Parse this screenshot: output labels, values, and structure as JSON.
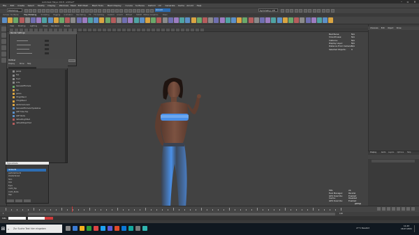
{
  "window": {
    "title": "Autodesk Maya 2018: untitled*",
    "minimize_icon": "minimize-icon",
    "maximize_icon": "maximize-icon",
    "close_icon": "close-icon"
  },
  "menubar": {
    "items": [
      "File",
      "Edit",
      "Create",
      "Select",
      "Modify",
      "Display",
      "Windows",
      "Mesh",
      "Edit Mesh",
      "Mesh Tools",
      "Mesh Display",
      "Curves",
      "Surfaces",
      "Deform",
      "UV",
      "Generate",
      "Cache",
      "Arnold",
      "Help"
    ]
  },
  "statusline": {
    "mode": "Modeling",
    "renderer": "Arnold",
    "panel": "Symmetry: Off"
  },
  "shelf": {
    "tabs": [
      "Curves / Surfaces",
      "Poly Modeling",
      "Sculpting",
      "Rigging",
      "Animation",
      "Rendering",
      "FX",
      "FX Caching",
      "Custom",
      "Arnold",
      "Bifrost",
      "MASH",
      "Motion Graphics",
      "XGen"
    ],
    "active_tab": "Poly Modeling"
  },
  "viewport": {
    "menu": [
      "View",
      "Shading",
      "Lighting",
      "Show",
      "Renderer",
      "Panels"
    ],
    "hud_left": {
      "labels": [
        "Verts:",
        "Edges:",
        "Faces:",
        "Tris:",
        "UVs:"
      ]
    },
    "hud_right": {
      "labels": [
        "Backfaces:",
        "Smoothness:",
        "Instance:",
        "Display Layer:",
        "Distance From Camera:",
        "Selected Objects:"
      ],
      "values": [
        "N/A",
        "N/A",
        "N/A",
        "N/A",
        "N/A",
        "0"
      ]
    },
    "hud_bottom": {
      "labels": [
        "FPS:",
        "Eval Manager:",
        "GPU Override:",
        "Cache:",
        "GPU Override:"
      ],
      "values": [
        "24",
        "Parallel",
        "Enabled",
        "Disabled",
        "Enabled"
      ],
      "camera": "persp"
    }
  },
  "settings_dialog": {
    "title": "Render Settings"
  },
  "outliner": {
    "title": "Outliner",
    "menu": [
      "Display",
      "Show",
      "Help"
    ],
    "rows": [
      "persp",
      "top",
      "front",
      "side",
      "Genesis8Female",
      "hip",
      "pelvis",
      "lThighBend",
      "rThighBend",
      "abdomenLower",
      "Genesis8Female Eyelashes",
      "G8F Tube Top",
      "G8F Pants",
      "defaultLightSet",
      "defaultObjectSet"
    ]
  },
  "small_window": {
    "title": "Hypershade",
    "rows": [
      "lambert1",
      "particleCloud1",
      "shaderGlow1",
      "Skin",
      "Lips",
      "Eyes",
      "Cloth_Top",
      "Cloth_Pants",
      "Hair"
    ]
  },
  "channel_box": {
    "tabs": [
      "Channels",
      "Edit",
      "Object",
      "Show"
    ],
    "layer_tabs": [
      "Display",
      "Anim"
    ],
    "layer_menu": [
      "Layers",
      "Options",
      "Help"
    ]
  },
  "timeline": {
    "start": "1",
    "end": "120",
    "current": "24"
  },
  "command_line": {
    "label": "MEL"
  },
  "taskbar": {
    "search_placeholder": "Zur Suche Text hier eingeben",
    "tray_text": "27°C  Bewölkt",
    "time": "11:43",
    "date": "16.07.2021"
  },
  "colors": {
    "accent": "#2d6db3",
    "clothing_glow": "#4a90e8"
  }
}
